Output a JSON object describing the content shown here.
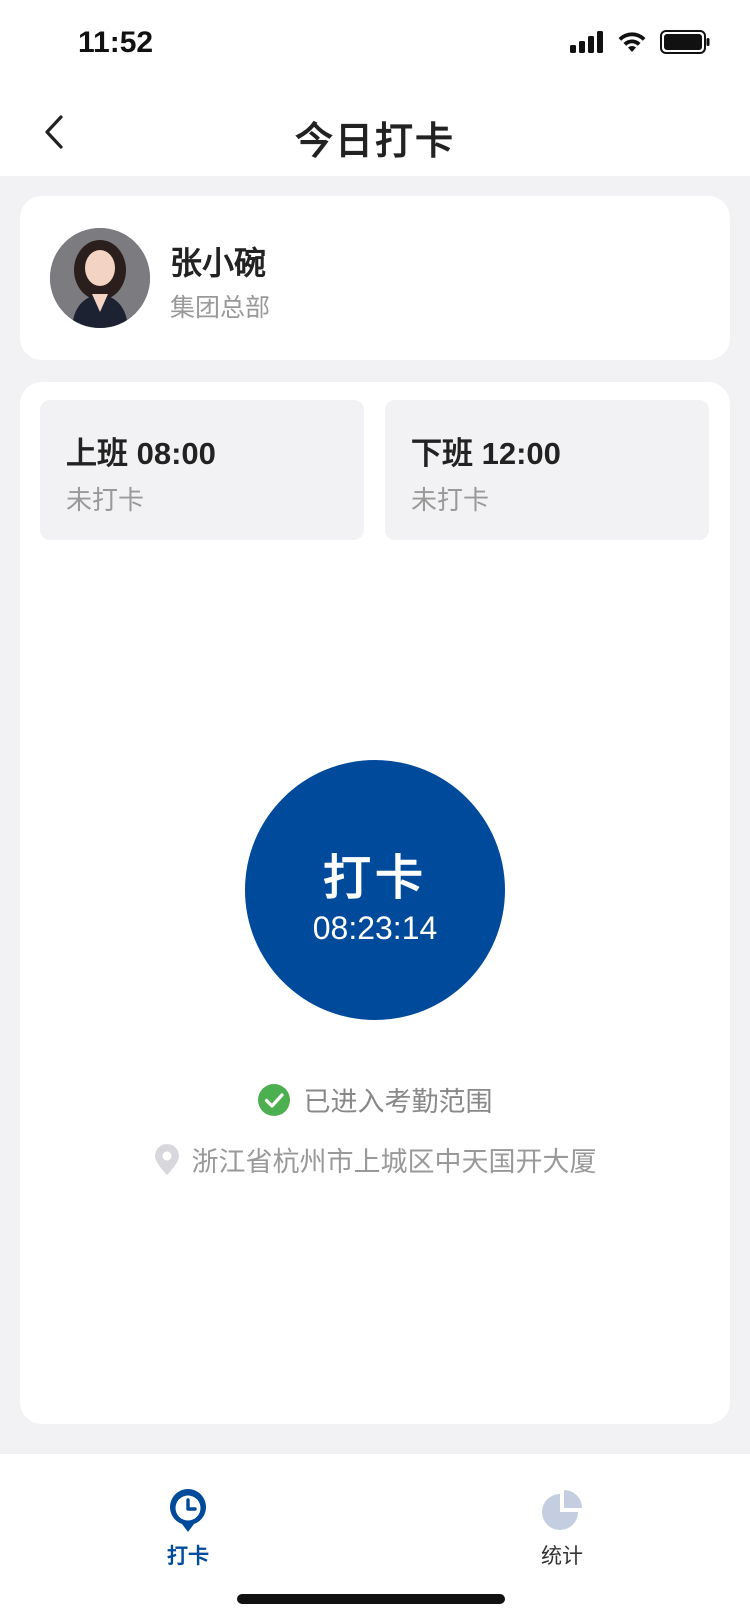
{
  "status_bar": {
    "time": "11:52"
  },
  "nav": {
    "title": "今日打卡",
    "back_icon": "chevron-left-icon"
  },
  "user": {
    "name": "张小碗",
    "department": "集团总部"
  },
  "shifts": [
    {
      "title": "上班 08:00",
      "status": "未打卡"
    },
    {
      "title": "下班 12:00",
      "status": "未打卡"
    }
  ],
  "punch": {
    "label": "打卡",
    "time": "08:23:14"
  },
  "location": {
    "range_status": "已进入考勤范围",
    "address": "浙江省杭州市上城区中天国开大厦"
  },
  "tabs": [
    {
      "label": "打卡",
      "icon": "clock-pin-icon",
      "active": true
    },
    {
      "label": "统计",
      "icon": "pie-chart-icon",
      "active": false
    }
  ],
  "colors": {
    "primary": "#004a9c",
    "success": "#4caf50",
    "background": "#f2f2f4",
    "inactive_icon": "#c5cde0"
  }
}
